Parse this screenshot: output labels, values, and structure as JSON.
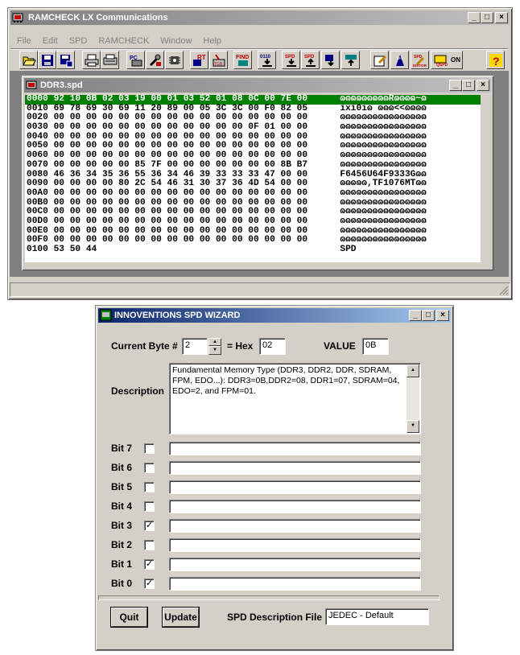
{
  "main_window": {
    "title": "RAMCHECK LX Communications",
    "menu": [
      "File",
      "Edit",
      "SPD",
      "RAMCHECK",
      "Window",
      "Help"
    ]
  },
  "toolbar": {
    "icons": [
      "open-icon",
      "save-icon",
      "save-as-icon",
      "print-icon",
      "printer-setup-icon",
      "pc-icon",
      "tool-icon",
      "chip-icon",
      "rt-icon",
      "tool2-icon",
      "find-icon",
      "download-0110-icon",
      "spd-download-icon",
      "spd-upload-icon",
      "transfer1-icon",
      "transfer2-icon",
      "spd-edit-icon",
      "spd-wizard-icon",
      "spd-editor-icon",
      "spd-on-icon",
      "help-icon"
    ],
    "labels": {
      "rt": "RT",
      "find": "FIND",
      "bits": "0110",
      "spd": "SPD",
      "on": "ON",
      "help": "?"
    }
  },
  "spd_window": {
    "title": "DDR3.spd",
    "rows": [
      {
        "addr": "0000",
        "hex": "92 10 0B 02 03 19 00 01 03 52 01 08 0C 00 7E 00",
        "ascii": "ɷɷɷɷɷɷɷɷɷRɷɷɷɷ~ɷ",
        "selected": true
      },
      {
        "addr": "0010",
        "hex": "69 78 69 30 69 11 20 89 00 05 3C 3C 00 F0 82 05",
        "ascii": "ixi0iɷ ɷɷɷ<<ɷɷɷɷ",
        "selected": false
      },
      {
        "addr": "0020",
        "hex": "00 00 00 00 00 00 00 00 00 00 00 00 00 00 00 00",
        "ascii": "ɷɷɷɷɷɷɷɷɷɷɷɷɷɷɷɷ",
        "selected": false
      },
      {
        "addr": "0030",
        "hex": "00 00 00 00 00 00 00 00 00 00 00 00 0F 01 00 00",
        "ascii": "ɷɷɷɷɷɷɷɷɷɷɷɷɷɷɷɷ",
        "selected": false
      },
      {
        "addr": "0040",
        "hex": "00 00 00 00 00 00 00 00 00 00 00 00 00 00 00 00",
        "ascii": "ɷɷɷɷɷɷɷɷɷɷɷɷɷɷɷɷ",
        "selected": false
      },
      {
        "addr": "0050",
        "hex": "00 00 00 00 00 00 00 00 00 00 00 00 00 00 00 00",
        "ascii": "ɷɷɷɷɷɷɷɷɷɷɷɷɷɷɷɷ",
        "selected": false
      },
      {
        "addr": "0060",
        "hex": "00 00 00 00 00 00 00 00 00 00 00 00 00 00 00 00",
        "ascii": "ɷɷɷɷɷɷɷɷɷɷɷɷɷɷɷɷ",
        "selected": false
      },
      {
        "addr": "0070",
        "hex": "00 00 00 00 00 85 7F 00 00 00 00 00 00 00 8B B7",
        "ascii": "ɷɷɷɷɷɷɷɷɷɷɷɷɷɷɷɷ",
        "selected": false
      },
      {
        "addr": "0080",
        "hex": "46 36 34 35 36 55 36 34 46 39 33 33 33 47 00 00",
        "ascii": "F6456U64F9333Gɷɷ",
        "selected": false
      },
      {
        "addr": "0090",
        "hex": "00 00 00 00 80 2C 54 46 31 30 37 36 4D 54 00 00",
        "ascii": "ɷɷɷɷɷ,TF1076MTɷɷ",
        "selected": false
      },
      {
        "addr": "00A0",
        "hex": "00 00 00 00 00 00 00 00 00 00 00 00 00 00 00 00",
        "ascii": "ɷɷɷɷɷɷɷɷɷɷɷɷɷɷɷɷ",
        "selected": false
      },
      {
        "addr": "00B0",
        "hex": "00 00 00 00 00 00 00 00 00 00 00 00 00 00 00 00",
        "ascii": "ɷɷɷɷɷɷɷɷɷɷɷɷɷɷɷɷ",
        "selected": false
      },
      {
        "addr": "00C0",
        "hex": "00 00 00 00 00 00 00 00 00 00 00 00 00 00 00 00",
        "ascii": "ɷɷɷɷɷɷɷɷɷɷɷɷɷɷɷɷ",
        "selected": false
      },
      {
        "addr": "00D0",
        "hex": "00 00 00 00 00 00 00 00 00 00 00 00 00 00 00 00",
        "ascii": "ɷɷɷɷɷɷɷɷɷɷɷɷɷɷɷɷ",
        "selected": false
      },
      {
        "addr": "00E0",
        "hex": "00 00 00 00 00 00 00 00 00 00 00 00 00 00 00 00",
        "ascii": "ɷɷɷɷɷɷɷɷɷɷɷɷɷɷɷɷ",
        "selected": false
      },
      {
        "addr": "00F0",
        "hex": "00 00 00 00 00 00 00 00 00 00 00 00 00 00 00 00",
        "ascii": "ɷɷɷɷɷɷɷɷɷɷɷɷɷɷɷɷ",
        "selected": false
      },
      {
        "addr": "0100",
        "hex": "53 50 44",
        "ascii": "SPD",
        "selected": false
      }
    ]
  },
  "wizard": {
    "title": "INNOVENTIONS SPD WIZARD",
    "current_byte_label": "Current Byte #",
    "current_byte_value": "2",
    "hex_label": "= Hex",
    "hex_value": "02",
    "value_label": "VALUE",
    "value_value": "0B",
    "description_label": "Description",
    "description_text": "Fundamental Memory Type (DDR3, DDR2, DDR, SDRAM, FPM, EDO...): DDR3=0B,DDR2=08, DDR1=07, SDRAM=04, EDO=2, and FPM=01.",
    "bits": [
      {
        "label": "Bit 7",
        "checked": false,
        "text": ""
      },
      {
        "label": "Bit 6",
        "checked": false,
        "text": ""
      },
      {
        "label": "Bit 5",
        "checked": false,
        "text": ""
      },
      {
        "label": "Bit 4",
        "checked": false,
        "text": ""
      },
      {
        "label": "Bit 3",
        "checked": true,
        "text": ""
      },
      {
        "label": "Bit 2",
        "checked": false,
        "text": ""
      },
      {
        "label": "Bit 1",
        "checked": true,
        "text": ""
      },
      {
        "label": "Bit 0",
        "checked": true,
        "text": ""
      }
    ],
    "quit_label": "Quit",
    "update_label": "Update",
    "spd_file_label": "SPD Description File",
    "spd_file_value": "JEDEC - Default",
    "check_mark": "✓"
  },
  "colors": {
    "selection": "#008000",
    "active_title": "#0a246a",
    "inactive_title": "#808080",
    "face": "#d4d0c8"
  }
}
